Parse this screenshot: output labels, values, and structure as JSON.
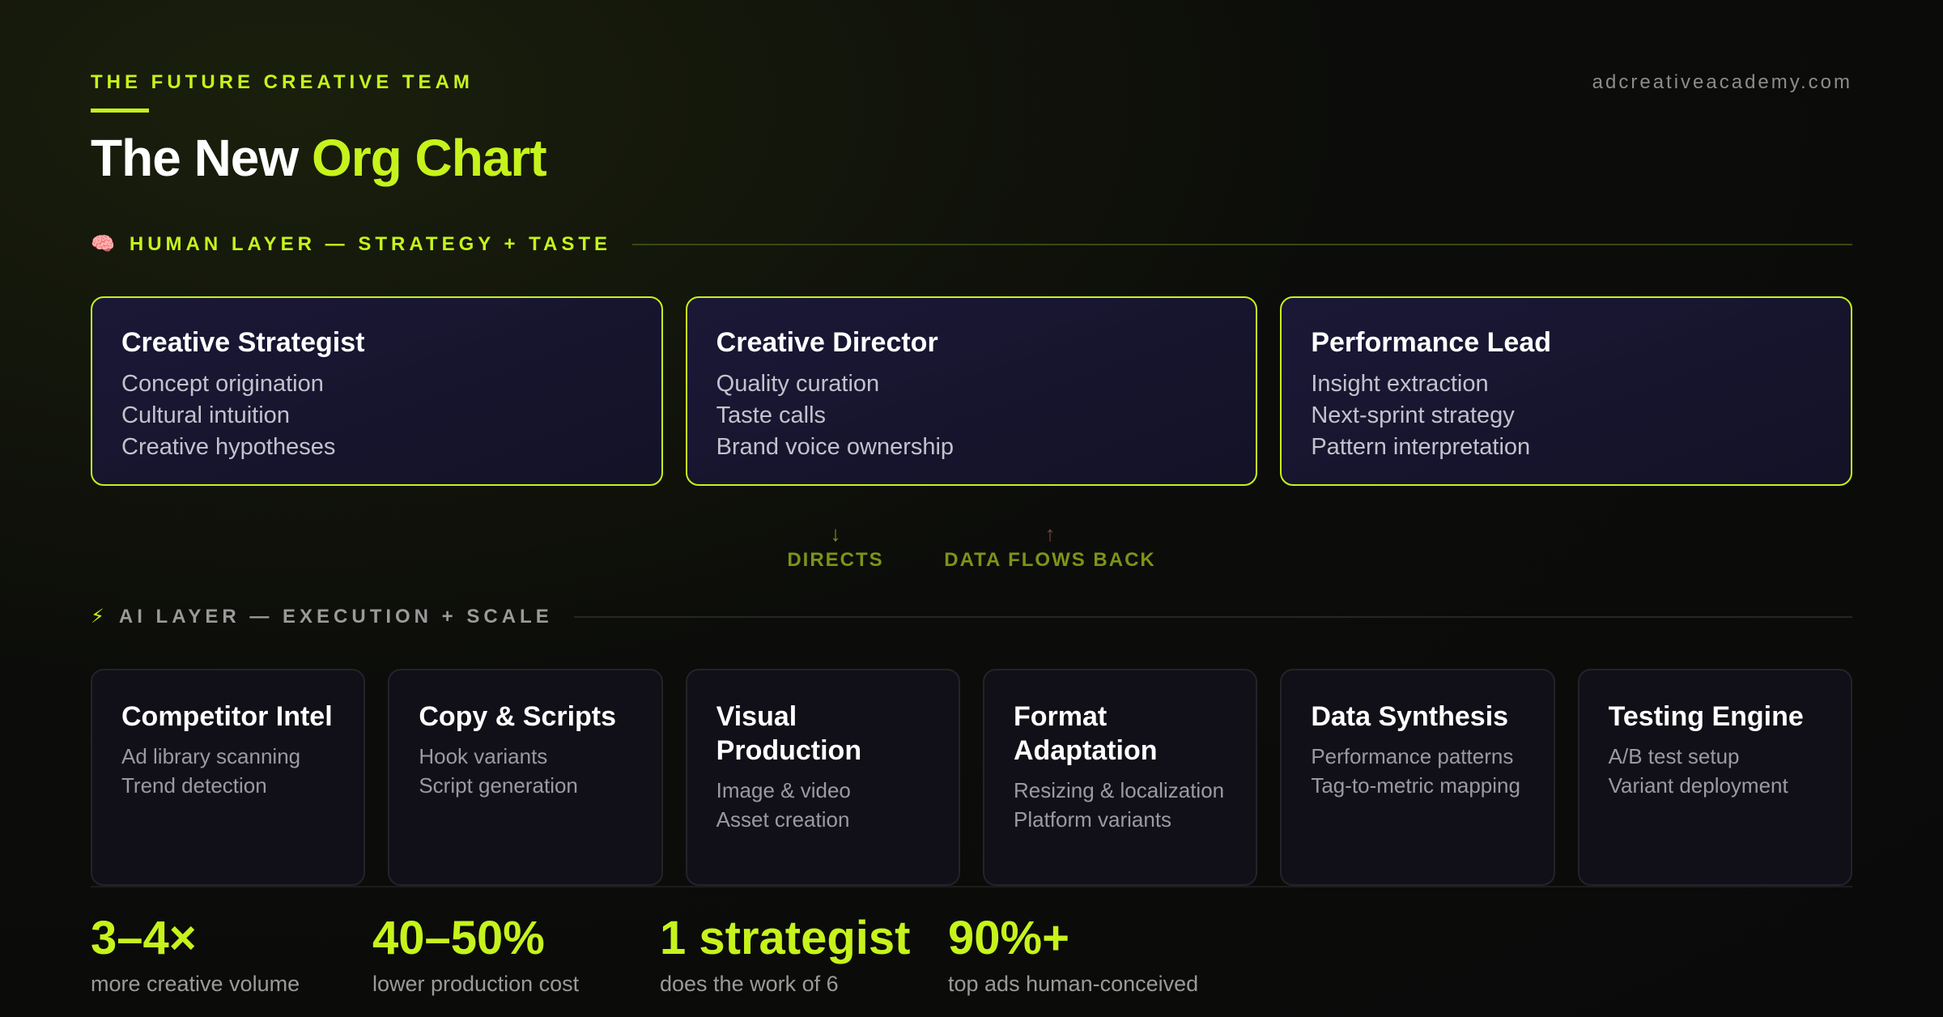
{
  "header": {
    "eyebrow": "THE FUTURE CREATIVE TEAM",
    "site": "adcreativeacademy.com",
    "title_main": "The New ",
    "title_accent": "Org Chart"
  },
  "human_layer": {
    "icon": "🧠",
    "label": "HUMAN LAYER — STRATEGY + TASTE",
    "cards": [
      {
        "name": "Creative Strategist",
        "items": [
          "Concept origination",
          "Cultural intuition",
          "Creative hypotheses"
        ]
      },
      {
        "name": "Creative Director",
        "items": [
          "Quality curation",
          "Taste calls",
          "Brand voice ownership"
        ]
      },
      {
        "name": "Performance Lead",
        "items": [
          "Insight extraction",
          "Next-sprint strategy",
          "Pattern interpretation"
        ]
      }
    ]
  },
  "flow": {
    "directs_arrow": "↓",
    "directs": "DIRECTS",
    "back_arrow": "↑",
    "back": "DATA FLOWS BACK"
  },
  "ai_layer": {
    "icon": "⚡",
    "label": "AI LAYER — EXECUTION + SCALE",
    "cards": [
      {
        "name": "Competitor Intel",
        "items": [
          "Ad library scanning",
          "Trend detection"
        ]
      },
      {
        "name": "Copy & Scripts",
        "items": [
          "Hook variants",
          "Script generation"
        ]
      },
      {
        "name": "Visual Production",
        "items": [
          "Image & video",
          "Asset creation"
        ]
      },
      {
        "name": "Format Adaptation",
        "items": [
          "Resizing & localization",
          "Platform variants"
        ]
      },
      {
        "name": "Data Synthesis",
        "items": [
          "Performance patterns",
          "Tag-to-metric mapping"
        ]
      },
      {
        "name": "Testing Engine",
        "items": [
          "A/B test setup",
          "Variant deployment"
        ]
      }
    ]
  },
  "stats": [
    {
      "value": "3–4×",
      "desc": "more creative volume"
    },
    {
      "value": "40–50%",
      "desc": "lower production cost"
    },
    {
      "value": "1 strategist",
      "desc": "does the work of 6"
    },
    {
      "value": "90%+",
      "desc": "top ads human-conceived"
    }
  ],
  "colors": {
    "accent": "#c6f31c",
    "background": "#0a0a0a",
    "card_human": "#161430",
    "card_ai": "#111018"
  }
}
